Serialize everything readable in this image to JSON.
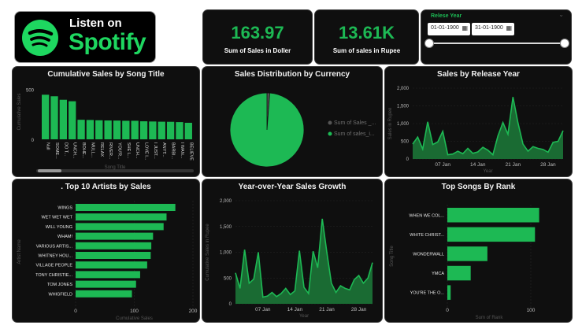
{
  "logo": {
    "listen_on": "Listen on",
    "brand": "Spotify",
    "icon": "spotify-logo-icon"
  },
  "kpis": [
    {
      "value": "163.97",
      "label": "Sum of Sales in Doller"
    },
    {
      "value": "13.61K",
      "label": "Sum of sales in Rupee"
    }
  ],
  "slicer": {
    "label": "Relese Year",
    "start": "01-01-1900",
    "end": "31-01-1900",
    "start_level": 0,
    "end_level": 1
  },
  "colors": {
    "accent": "#1db954",
    "bar": "#1db954",
    "area_fill": "#1a6b33",
    "panel": "#0f0f0f",
    "axis_text": "#bdbdbd",
    "muted": "#555555"
  },
  "panels": {
    "cumulative": "Cumulative Sales by Song Title",
    "currency": "Sales Distribution by Currency",
    "release_year": "Sales by Release Year",
    "top_artists": ". Top 10 Artists by Sales",
    "yoy": "Year-over-Year Sales Growth",
    "top_songs": "Top Songs By Rank"
  },
  "chart_data": [
    {
      "id": "cumulative",
      "type": "bar",
      "title": "Cumulative Sales by Song Title",
      "xlabel": "Song Title",
      "ylabel": "Cumulative Sales",
      "ylim": [
        0,
        550
      ],
      "yticks": [
        "0",
        "500"
      ],
      "categories": [
        "Null",
        "SOME...",
        "DO T...",
        "UNCH...",
        "BOHE...",
        "MULL...",
        "RELAX",
        "RIVER...",
        "YOU'R...",
        "SHE L...",
        "UNCH...",
        "LOVE I...",
        "I JUST...",
        "ANYT...",
        "BARBI...",
        "I WAN...",
        "BELIEVE"
      ],
      "values": [
        445,
        430,
        395,
        380,
        195,
        193,
        190,
        188,
        187,
        185,
        185,
        180,
        178,
        176,
        175,
        172,
        165
      ]
    },
    {
      "id": "currency",
      "type": "pie",
      "title": "Sales Distribution by Currency",
      "labels": [
        "Sum of Sales _...",
        "Sum of sales_i..."
      ],
      "values": [
        163.97,
        13610
      ]
    },
    {
      "id": "release_year",
      "type": "area",
      "title": "Sales by Release Year",
      "xlabel": "Year",
      "ylabel": "Sales in Rupee",
      "ylim": [
        0,
        2000
      ],
      "yticks": [
        "0",
        "500",
        "1,000",
        "1,500",
        "2,000"
      ],
      "xticks": [
        "07 Jan",
        "14 Jan",
        "21 Jan",
        "28 Jan"
      ],
      "x": [
        1,
        2,
        3,
        4,
        5,
        6,
        7,
        8,
        9,
        10,
        11,
        12,
        13,
        14,
        15,
        16,
        17,
        18,
        19,
        20,
        21,
        22,
        23,
        24,
        25,
        26,
        27,
        28,
        29,
        30,
        31
      ],
      "values": [
        420,
        620,
        280,
        1050,
        410,
        480,
        780,
        120,
        140,
        220,
        150,
        300,
        160,
        200,
        330,
        250,
        120,
        650,
        1030,
        700,
        1750,
        1020,
        420,
        220,
        350,
        300,
        270,
        190,
        470,
        500,
        800
      ]
    },
    {
      "id": "top_artists",
      "type": "bar",
      "orientation": "horizontal",
      "title": ". Top 10 Artists by Sales",
      "xlabel": "Cumulative Sales",
      "ylabel": "Artist Name",
      "xlim": [
        0,
        200
      ],
      "xticks": [
        "0",
        "100",
        "200"
      ],
      "categories": [
        "WINGS",
        "WET WET WET",
        "WILL YOUNG",
        "WHAM!",
        "VARIOUS ARTIS...",
        "WHITNEY HOU...",
        "VILLAGE PEOPLE",
        "TONY CHRISTIE...",
        "TOM JONES",
        "WHIGFIELD"
      ],
      "values": [
        170,
        155,
        150,
        132,
        129,
        128,
        122,
        110,
        103,
        96
      ]
    },
    {
      "id": "yoy",
      "type": "area",
      "title": "Year-over-Year Sales Growth",
      "xlabel": "Year",
      "ylabel": "Cumulative Sales in Rupee",
      "ylim": [
        0,
        2000
      ],
      "yticks": [
        "0",
        "500",
        "1,000",
        "1,500",
        "2,000"
      ],
      "xticks": [
        "07 Jan",
        "14 Jan",
        "21 Jan",
        "28 Jan"
      ],
      "x": [
        1,
        2,
        3,
        4,
        5,
        6,
        7,
        8,
        9,
        10,
        11,
        12,
        13,
        14,
        15,
        16,
        17,
        18,
        19,
        20,
        21,
        22,
        23,
        24,
        25,
        26,
        27,
        28,
        29,
        30,
        31
      ],
      "values": [
        600,
        300,
        1050,
        400,
        480,
        1000,
        130,
        150,
        220,
        140,
        200,
        300,
        180,
        250,
        1030,
        320,
        200,
        1020,
        700,
        1650,
        1000,
        400,
        220,
        350,
        300,
        270,
        470,
        550,
        400,
        500,
        800
      ]
    },
    {
      "id": "top_songs",
      "type": "bar",
      "orientation": "horizontal",
      "title": "Top Songs By Rank",
      "xlabel": "Sum of Rank",
      "ylabel": "Song Title",
      "xlim": [
        0,
        100
      ],
      "xticks": [
        "0",
        "100"
      ],
      "categories": [
        "WHEN WE COL...",
        "WHITE CHRIST...",
        "WONDERWALL",
        "YMCA",
        "YOU'RE THE O..."
      ],
      "values": [
        110,
        105,
        48,
        28,
        4
      ]
    }
  ]
}
